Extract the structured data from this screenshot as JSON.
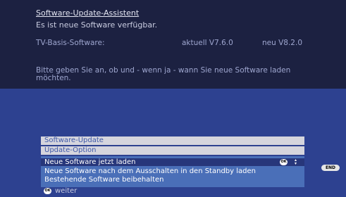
{
  "dialog": {
    "title": "Software-Update-Assistent",
    "subtitle": "Es ist neue Software verfügbar.",
    "software_row": {
      "label": "TV-Basis-Software:",
      "current": "aktuell V7.6.0",
      "new": "neu V8.2.0"
    },
    "instruction": "Bitte geben Sie an, ob und - wenn ja - wann Sie neue Software laden möchten."
  },
  "menu": {
    "header1": "Software-Update",
    "header2": "Update-Option",
    "options": [
      {
        "label": "Neue Software jetzt laden",
        "selected": true
      },
      {
        "label": "Neue Software nach dem Ausschalten in den Standby laden",
        "selected": false
      },
      {
        "label": "Bestehende Software beibehalten",
        "selected": false
      }
    ]
  },
  "buttons": {
    "ok_label": "OK",
    "end_label": "END"
  },
  "footer": {
    "ok_label": "OK",
    "label": "weiter"
  },
  "colors": {
    "top_panel": "#1c2141",
    "mid_panel": "#2d4190",
    "highlight": "#27367a",
    "option_bg": "#4a6fb8",
    "header_bg": "#d5d5dd"
  },
  "icons": {
    "ok": "ok-icon",
    "updown": "up-down-arrows-icon"
  }
}
